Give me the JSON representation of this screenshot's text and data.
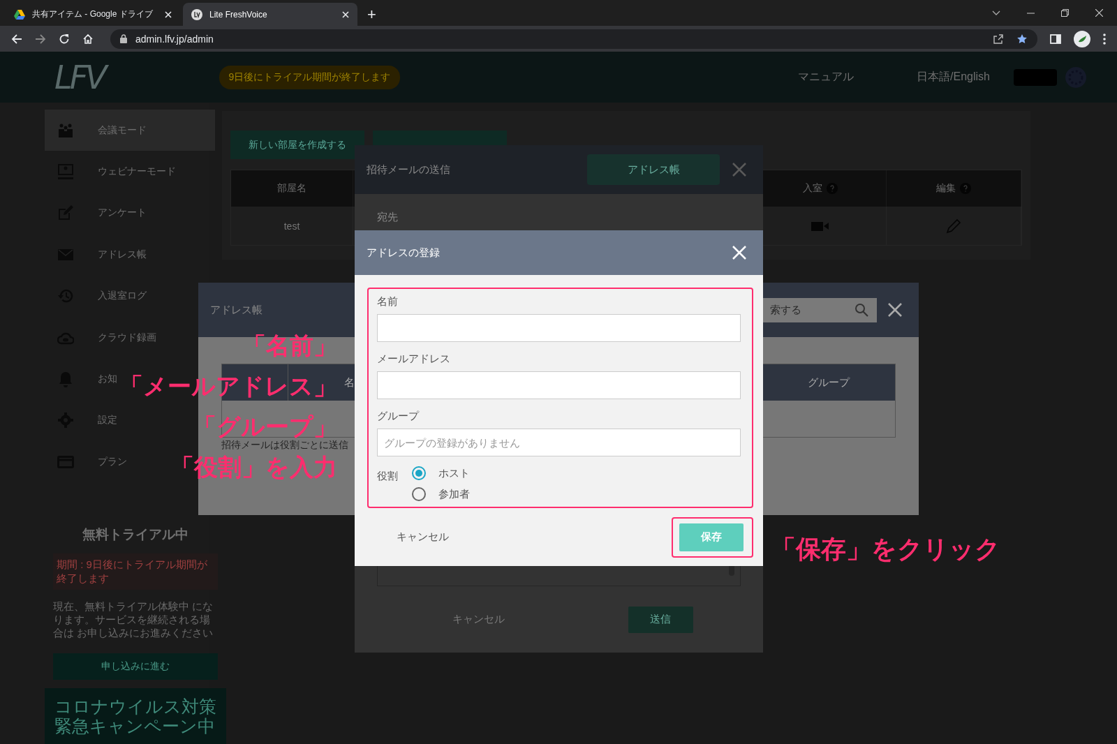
{
  "browser": {
    "tabs": [
      {
        "title": "共有アイテム - Google ドライブ",
        "selected": false
      },
      {
        "title": "Lite FreshVoice",
        "selected": true
      }
    ],
    "new_tab": "+",
    "url": "admin.lfv.jp/admin"
  },
  "header": {
    "logo": "LFV",
    "trial_badge": "9日後にトライアル期間が終了します",
    "links": [
      "マニュアル",
      "日本語/English"
    ]
  },
  "sidebar": {
    "items": [
      {
        "label": "会議モード",
        "selected": true
      },
      {
        "label": "ウェビナーモード",
        "selected": false
      },
      {
        "label": "アンケート",
        "selected": false
      },
      {
        "label": "アドレス帳",
        "selected": false
      },
      {
        "label": "入退室ログ",
        "selected": false
      },
      {
        "label": "クラウド録画",
        "selected": false
      },
      {
        "label": "お知",
        "selected": false
      },
      {
        "label": "設定",
        "selected": false
      },
      {
        "label": "プラン",
        "selected": false
      }
    ]
  },
  "trial": {
    "title": "無料トライアル中",
    "notice": "期間 : 9日後にトライアル期間が終了します",
    "description": "現在、無料トライアル体験中 になります。サービスを継続される場合は お申し込みにお進みください",
    "button": "申し込みに進む",
    "campaign": [
      "コロナウイルス対策",
      "緊急キャンペーン中"
    ]
  },
  "rooms": {
    "create_button": "新しい部屋を作成する",
    "columns": [
      {
        "label": "部屋名",
        "help": false
      },
      {
        "label": "入室",
        "help": true
      },
      {
        "label": "編集",
        "help": true
      }
    ],
    "rows": [
      {
        "name": "test"
      }
    ]
  },
  "invite_dialog": {
    "title": "招待メールの送信",
    "address_book_button": "アドレス帳",
    "to_label": "宛先",
    "cancel": "キャンセル",
    "send": "送信"
  },
  "address_book": {
    "title": "アドレス帳",
    "search_placeholder": "索する",
    "columns": [
      "名",
      "グループ"
    ],
    "note": "招待メールは役割ごとに送信"
  },
  "register_dialog": {
    "title": "アドレスの登録",
    "fields": [
      {
        "label": "名前"
      },
      {
        "label": "メールアドレス"
      },
      {
        "label": "グループ",
        "placeholder": "グループの登録がありません"
      }
    ],
    "role": {
      "label": "役割",
      "options": [
        {
          "label": "ホスト",
          "selected": true
        },
        {
          "label": "参加者",
          "selected": false
        }
      ]
    },
    "cancel": "キャンセル",
    "save": "保存"
  },
  "annotations": {
    "fields_note": [
      "「名前」",
      "「メールアドレス」",
      "「グループ」",
      "「役割」を入力"
    ],
    "save_note": "「保存」をクリック"
  }
}
